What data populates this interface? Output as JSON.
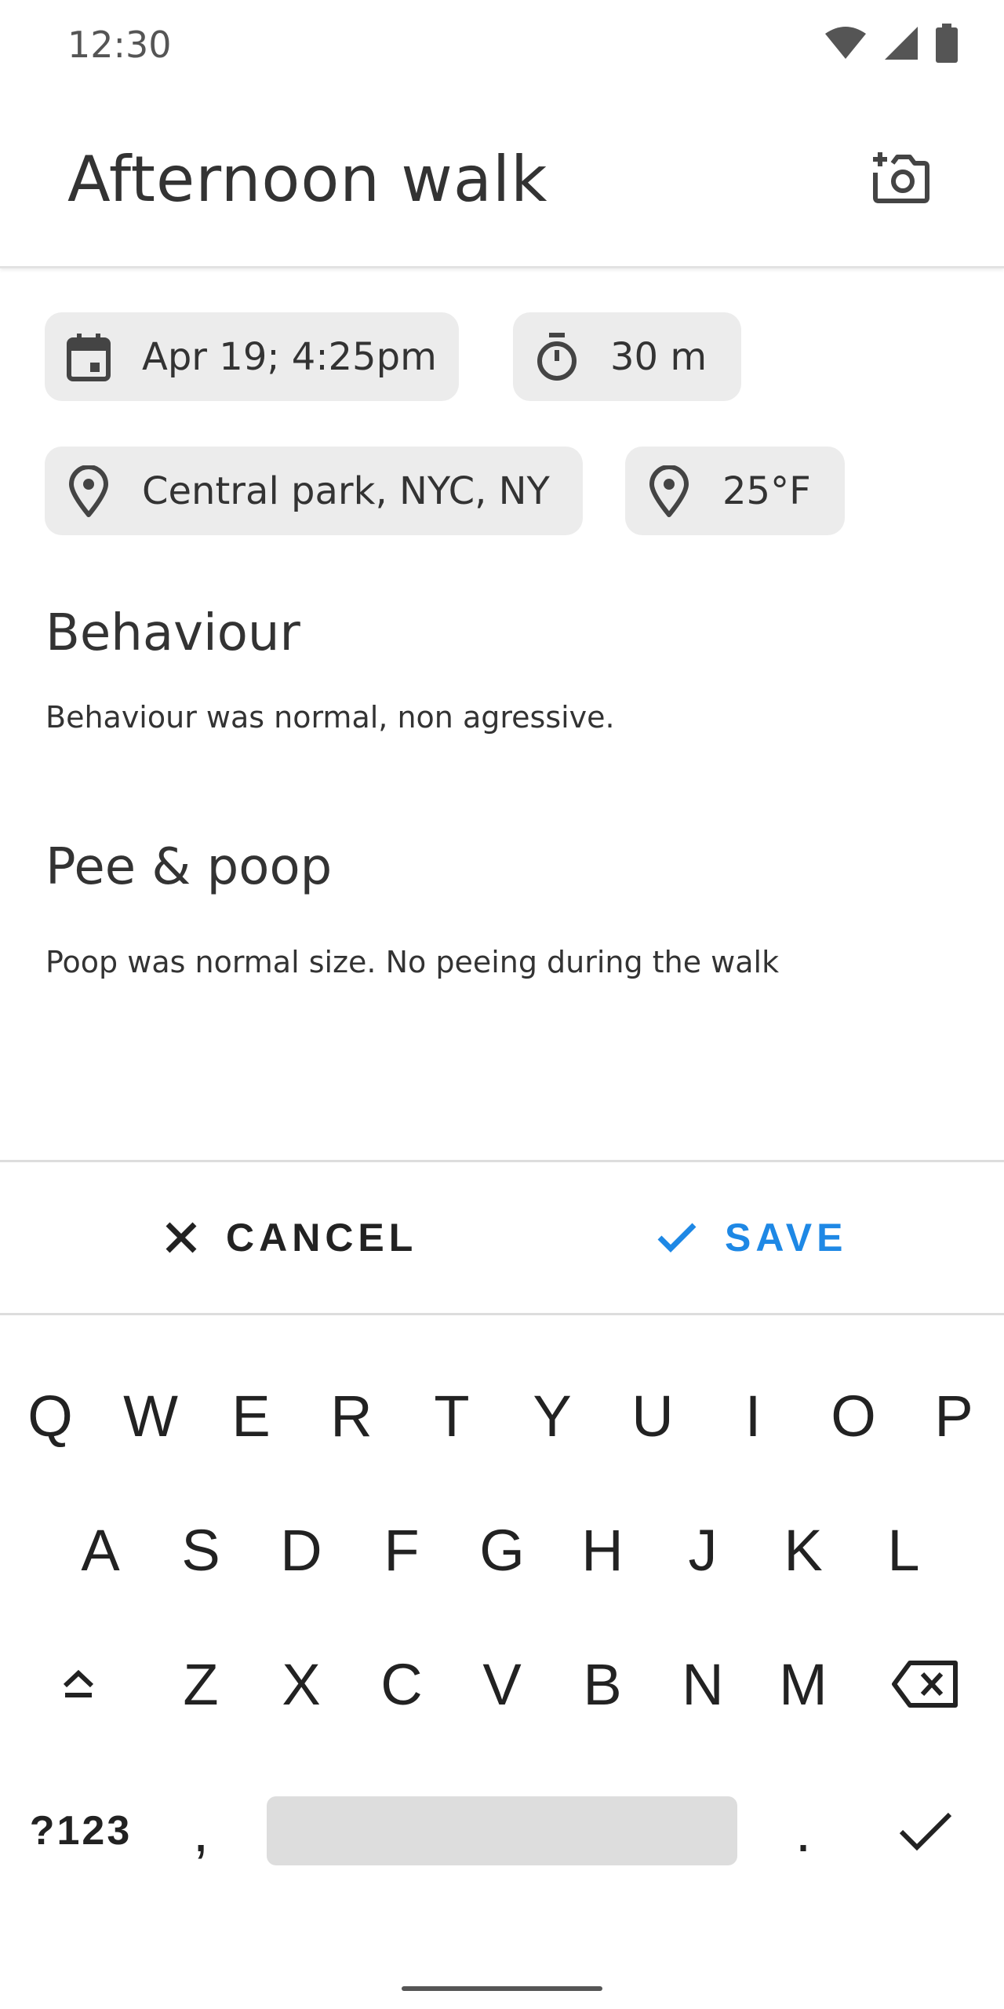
{
  "status_bar": {
    "time": "12:30",
    "icons": [
      "wifi-icon",
      "signal-icon",
      "battery-icon"
    ]
  },
  "app_bar": {
    "title": "Afternoon walk",
    "action_icon": "add-photo-icon"
  },
  "chips": {
    "date": {
      "icon": "calendar-icon",
      "label": "Apr 19; 4:25pm"
    },
    "duration": {
      "icon": "timer-icon",
      "label": "30 m"
    },
    "location": {
      "icon": "location-pin-icon",
      "label": "Central park, NYC, NY"
    },
    "temperature": {
      "icon": "location-pin-icon",
      "label": "25°F"
    }
  },
  "sections": {
    "behaviour": {
      "title": "Behaviour",
      "body": "Behaviour was normal, non agressive."
    },
    "pee_poop": {
      "title": "Pee & poop",
      "body": "Poop was normal size. No peeing during the walk"
    }
  },
  "actions": {
    "cancel": {
      "icon": "close-icon",
      "label": "CANCEL"
    },
    "save": {
      "icon": "check-icon",
      "label": "SAVE"
    }
  },
  "colors": {
    "accent": "#1e88e5",
    "chip_bg": "#ececec",
    "text": "#333333"
  },
  "keyboard": {
    "row1": [
      "Q",
      "W",
      "E",
      "R",
      "T",
      "Y",
      "U",
      "I",
      "O",
      "P"
    ],
    "row2": [
      "A",
      "S",
      "D",
      "F",
      "G",
      "H",
      "J",
      "K",
      "L"
    ],
    "row3": [
      "Z",
      "X",
      "C",
      "V",
      "B",
      "N",
      "M"
    ],
    "bottom": {
      "symbols": "?123",
      "comma": ",",
      "period": "."
    },
    "special_icons": [
      "shift-icon",
      "backspace-icon",
      "enter-check-icon"
    ]
  }
}
